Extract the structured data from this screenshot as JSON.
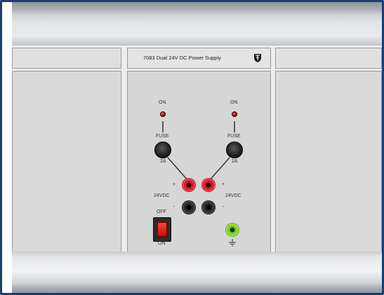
{
  "panel": {
    "title": "7083 Dual 24V DC Power Supply"
  },
  "channels": [
    {
      "on_label": "ON",
      "fuse_label": "FUSE",
      "fuse_rating": "2A",
      "voltage_label": "24VDC",
      "plus": "+",
      "minus": "-"
    },
    {
      "on_label": "ON",
      "fuse_label": "FUSE",
      "fuse_rating": "2A",
      "voltage_label": "24VDC",
      "plus": "+",
      "minus": "-"
    }
  ],
  "power_switch": {
    "off_label": "OFF",
    "on_label": "ON"
  },
  "icons": {
    "logo": "lab-volt-logo-icon",
    "ground": "ground-icon"
  },
  "colors": {
    "frame_border": "#1d3d6e",
    "jack_positive": "#d41e2a",
    "jack_negative": "#1a1a1a",
    "jack_ground": "#7fcf2a",
    "switch_rocker": "#e02020"
  }
}
